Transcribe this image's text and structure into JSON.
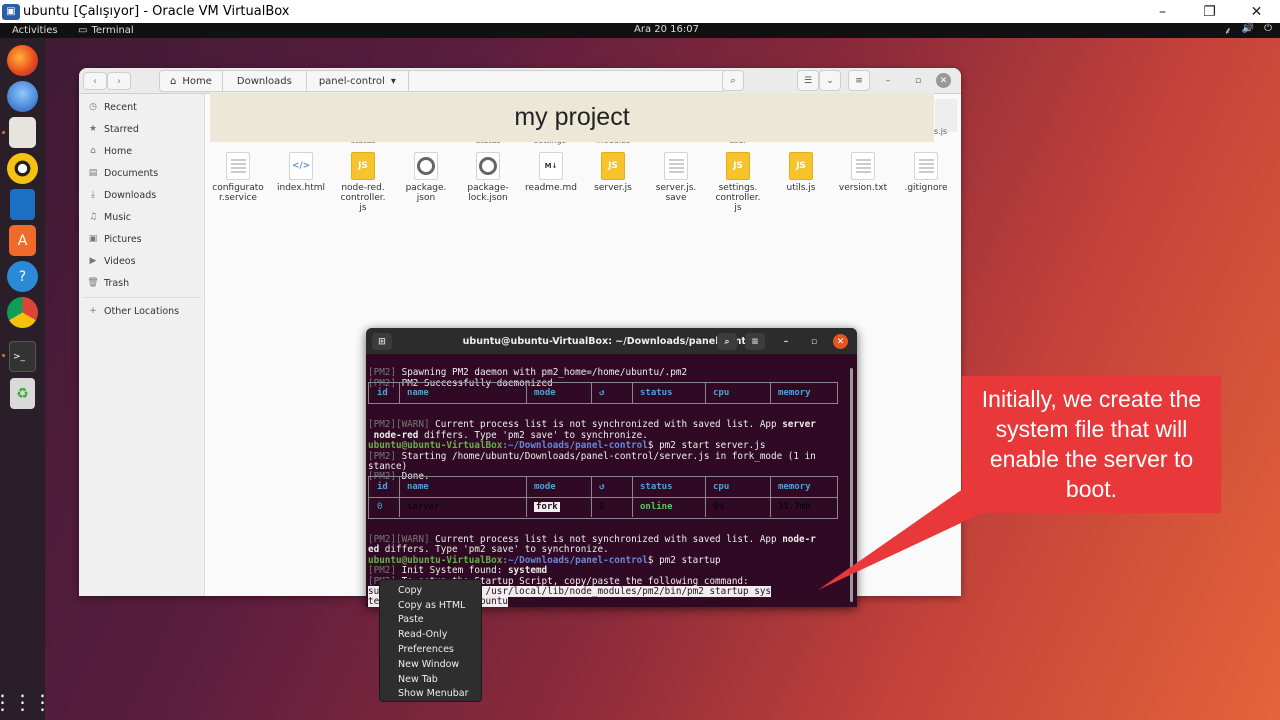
{
  "vbox": {
    "title": "ubuntu [Çalışıyor] - Oracle VM VirtualBox",
    "minimize": "–",
    "restore": "❐",
    "close": "✕"
  },
  "topbar": {
    "activities": "Activities",
    "app": "Terminal",
    "clock": "Ara 20  16:07",
    "tray": [
      "⸙",
      "🔊",
      "⏻"
    ]
  },
  "dock": [
    "Firefox",
    "Thunderbird",
    "Files",
    "Rhythmbox",
    "Writer",
    "Software",
    "Help",
    "Chrome",
    "Terminal",
    "Trash"
  ],
  "fm": {
    "path": [
      "Home",
      "Downloads",
      "panel-control"
    ],
    "dropdown": "▾",
    "sidebar": [
      "Recent",
      "Starred",
      "Home",
      "Documents",
      "Downloads",
      "Music",
      "Pictures",
      "Videos",
      "Trash",
      "Other Locations"
    ],
    "banner": "my project",
    "banner_frag": "s.js",
    "ghost": [
      "status",
      "status",
      "settings",
      "modules",
      "user"
    ],
    "files": [
      {
        "name": "configurato\nr.service",
        "kind": "txt"
      },
      {
        "name": "index.html",
        "kind": "html"
      },
      {
        "name": "node-red.\ncontroller.\njs",
        "kind": "js"
      },
      {
        "name": "package.\njson",
        "kind": "json"
      },
      {
        "name": "package-\nlock.json",
        "kind": "json"
      },
      {
        "name": "readme.md",
        "kind": "md"
      },
      {
        "name": "server.js",
        "kind": "js"
      },
      {
        "name": "server.js.\nsave",
        "kind": "txt"
      },
      {
        "name": "settings.\ncontroller.\njs",
        "kind": "js"
      },
      {
        "name": "utils.js",
        "kind": "js"
      },
      {
        "name": "version.txt",
        "kind": "txt"
      },
      {
        "name": ".gitignore",
        "kind": "txt"
      }
    ]
  },
  "terminal": {
    "title": "ubuntu@ubuntu-VirtualBox: ~/Downloads/panel-control",
    "prompt_user": "ubuntu@ubuntu-VirtualBox",
    "prompt_path": ":~/Downloads/panel-control",
    "lines": {
      "l1": " Spawning PM2 daemon with pm2_home=/home/ubuntu/.pm2",
      "l2": " PM2 Successfully daemonized",
      "warn1a": " Current process list is not synchronized with saved list. App ",
      "warn1b": "server",
      "warn1c": " node-red",
      "warn1d": " differs. Type 'pm2 save' to synchronize.",
      "cmd1": "$ pm2 start server.js",
      "start1": " Starting /home/ubuntu/Downloads/panel-control/server.js in fork_mode (1 in",
      "start2": "stance)",
      "done": " Done.",
      "warn2a": " Current process list is not synchronized with saved list. App ",
      "warn2b": "node-r",
      "warn2c": "ed",
      "warn2d": " differs. Type 'pm2 save' to synchronize.",
      "cmd2": "$ pm2 startup",
      "init": " Init System found: ",
      "initv": "systemd",
      "setup": " To setup the Startup Script, copy/paste the following command:",
      "sel1": "/usr/bin /usr/local/lib/node_modules/pm2/bin/pm2 startup sys",
      "sel2": "/home/ubuntu",
      "cmd3": "$ ",
      "pm2tag": "[PM2]",
      "warntag": "[PM2][WARN]",
      "su": "su",
      "te": "te"
    },
    "table_headers": [
      "id",
      "name",
      "mode",
      "↺",
      "status",
      "cpu",
      "memory"
    ],
    "row": {
      "id": "0",
      "name": "server",
      "mode": "fork",
      "restarts": "0",
      "status": "online",
      "cpu": "0%",
      "memory": "31.7mb"
    }
  },
  "context_menu": [
    "Copy",
    "Copy as HTML",
    "Paste",
    "Read-Only",
    "Preferences",
    "New Window",
    "New Tab",
    "Show Menubar"
  ],
  "callout": "Initially, we create the system file that will enable the server to boot."
}
